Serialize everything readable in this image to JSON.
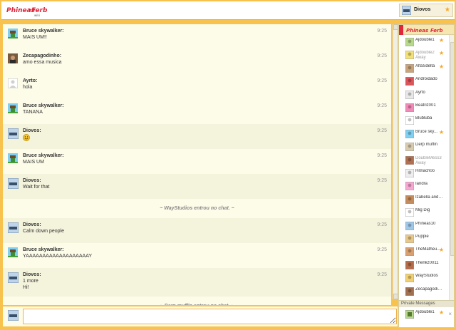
{
  "header": {
    "logo_text": "Phineas and Ferb",
    "me": {
      "name": "Diovos"
    }
  },
  "colors": {
    "accent": "#f8c24e",
    "chat_bg": "#fdfce9",
    "shaded": "#f4f3dc",
    "star": "#f5a623"
  },
  "messages": [
    {
      "kind": "msg",
      "name": "Bruce skywalker:",
      "lines": [
        "MAIS UM!!"
      ],
      "time": "9:25",
      "avatar": "pixel-avatar-icon",
      "shaded": false
    },
    {
      "kind": "msg",
      "name": "Zecapagodinho:",
      "lines": [
        "amo essa musica"
      ],
      "time": "9:25",
      "avatar": "photo-avatar-icon",
      "shaded": false
    },
    {
      "kind": "msg",
      "name": "Ayrto:",
      "lines": [
        "hola"
      ],
      "time": "9:25",
      "avatar": "default-avatar-icon",
      "shaded": false
    },
    {
      "kind": "msg",
      "name": "Bruce skywalker:",
      "lines": [
        "TANANA"
      ],
      "time": "9:25",
      "avatar": "pixel-avatar-icon",
      "shaded": false
    },
    {
      "kind": "msg",
      "name": "Diovos:",
      "lines": [
        ""
      ],
      "time": "9:25",
      "avatar": "diovos-avatar-icon",
      "shaded": true,
      "emoji": "smiley-emoji-icon"
    },
    {
      "kind": "msg",
      "name": "Bruce skywalker:",
      "lines": [
        "MAIS UM"
      ],
      "time": "9:25",
      "avatar": "pixel-avatar-icon",
      "shaded": false
    },
    {
      "kind": "msg",
      "name": "Diovos:",
      "lines": [
        "Wait for that"
      ],
      "time": "9:25",
      "avatar": "diovos-avatar-icon",
      "shaded": true
    },
    {
      "kind": "inform",
      "text": "~ WayStudios entrou no chat. ~"
    },
    {
      "kind": "msg",
      "name": "Diovos:",
      "lines": [
        "Calm down people"
      ],
      "time": "9:25",
      "avatar": "diovos-avatar-icon",
      "shaded": true
    },
    {
      "kind": "msg",
      "name": "Bruce skywalker:",
      "lines": [
        "YAAAAAAAAAAAAAAAAAAAY"
      ],
      "time": "9:25",
      "avatar": "pixel-avatar-icon",
      "shaded": false
    },
    {
      "kind": "msg",
      "name": "Diovos:",
      "lines": [
        "1 more",
        "Hi!"
      ],
      "time": "9:25",
      "avatar": "diovos-avatar-icon",
      "shaded": true
    },
    {
      "kind": "inform",
      "text": "~ Derp muffin entrou no chat. ~"
    }
  ],
  "composer": {
    "value": "",
    "placeholder": ""
  },
  "sidebar": {
    "users": [
      {
        "name": "Ajdouble1",
        "status": "",
        "star": true,
        "away": false
      },
      {
        "name": "Ajdouble2",
        "status": "Away",
        "star": true,
        "away": true
      },
      {
        "name": "AlfaSdelta",
        "status": "",
        "star": true,
        "away": false
      },
      {
        "name": "Androidado",
        "status": "",
        "star": false,
        "away": false
      },
      {
        "name": "Ayrto",
        "status": "",
        "star": false,
        "away": false
      },
      {
        "name": "Beatriz001",
        "status": "",
        "star": false,
        "away": false
      },
      {
        "name": "Blubluba",
        "status": "",
        "star": false,
        "away": false
      },
      {
        "name": "Bruce sky...",
        "status": "",
        "star": true,
        "away": false
      },
      {
        "name": "Derp muffin",
        "status": "",
        "star": false,
        "away": false
      },
      {
        "name": "DoubleMess3",
        "status": "Away",
        "star": false,
        "away": true
      },
      {
        "name": "Hitnach0o",
        "status": "",
        "star": false,
        "away": false
      },
      {
        "name": "Iandra",
        "status": "",
        "star": false,
        "away": false
      },
      {
        "name": "Izabella and L...",
        "status": "",
        "star": false,
        "away": false
      },
      {
        "name": "Mig Dig",
        "status": "",
        "star": false,
        "away": false
      },
      {
        "name": "Phineas10",
        "status": "",
        "star": false,
        "away": false
      },
      {
        "name": "Puppie",
        "status": "",
        "star": false,
        "away": false
      },
      {
        "name": "TheMatheu...",
        "status": "",
        "star": true,
        "away": false
      },
      {
        "name": "Thenkz0011",
        "status": "",
        "star": false,
        "away": false
      },
      {
        "name": "WayStudios",
        "status": "",
        "star": false,
        "away": false
      },
      {
        "name": "Zecapagodinho",
        "status": "",
        "star": false,
        "away": false
      }
    ],
    "private_messages_label": "Private Messages",
    "private_user": {
      "name": "Ajdouble1",
      "star": true
    }
  }
}
